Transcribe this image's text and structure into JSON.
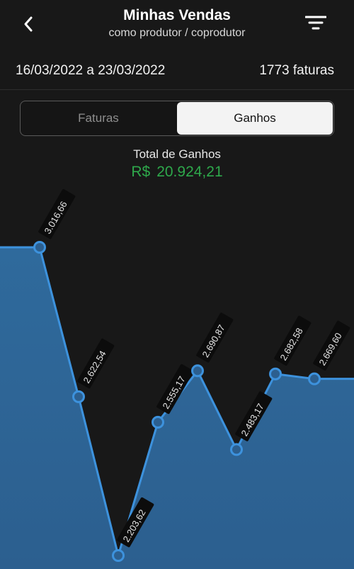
{
  "header": {
    "title": "Minhas Vendas",
    "subtitle": "como produtor / coprodutor",
    "back_icon": "chevron-left-icon",
    "filter_icon": "filter-icon"
  },
  "summary": {
    "period": "16/03/2022 a 23/03/2022",
    "invoice_count": "1773 faturas"
  },
  "tabs": [
    {
      "label": "Faturas",
      "active": false
    },
    {
      "label": "Ganhos",
      "active": true
    }
  ],
  "total": {
    "label": "Total de Ganhos",
    "currency": "R$",
    "value": "20.924,21"
  },
  "colors": {
    "positive": "#2ea84b",
    "line": "#3d92dd",
    "area": "#2c5f8f",
    "background": "#181818"
  },
  "chart_data": {
    "type": "area",
    "title": "",
    "xlabel": "",
    "ylabel": "",
    "ylim": [
      2203.62,
      3016.66
    ],
    "grid": false,
    "values": [
      3016.66,
      2622.54,
      2203.62,
      2555.17,
      2690.87,
      2483.17,
      2682.58,
      2669.6
    ],
    "labels": [
      "3.016,66",
      "2.622,54",
      "2.203,62",
      "2.555,17",
      "2.690,87",
      "2.483,17",
      "2.682,58",
      "2.669,60"
    ]
  }
}
